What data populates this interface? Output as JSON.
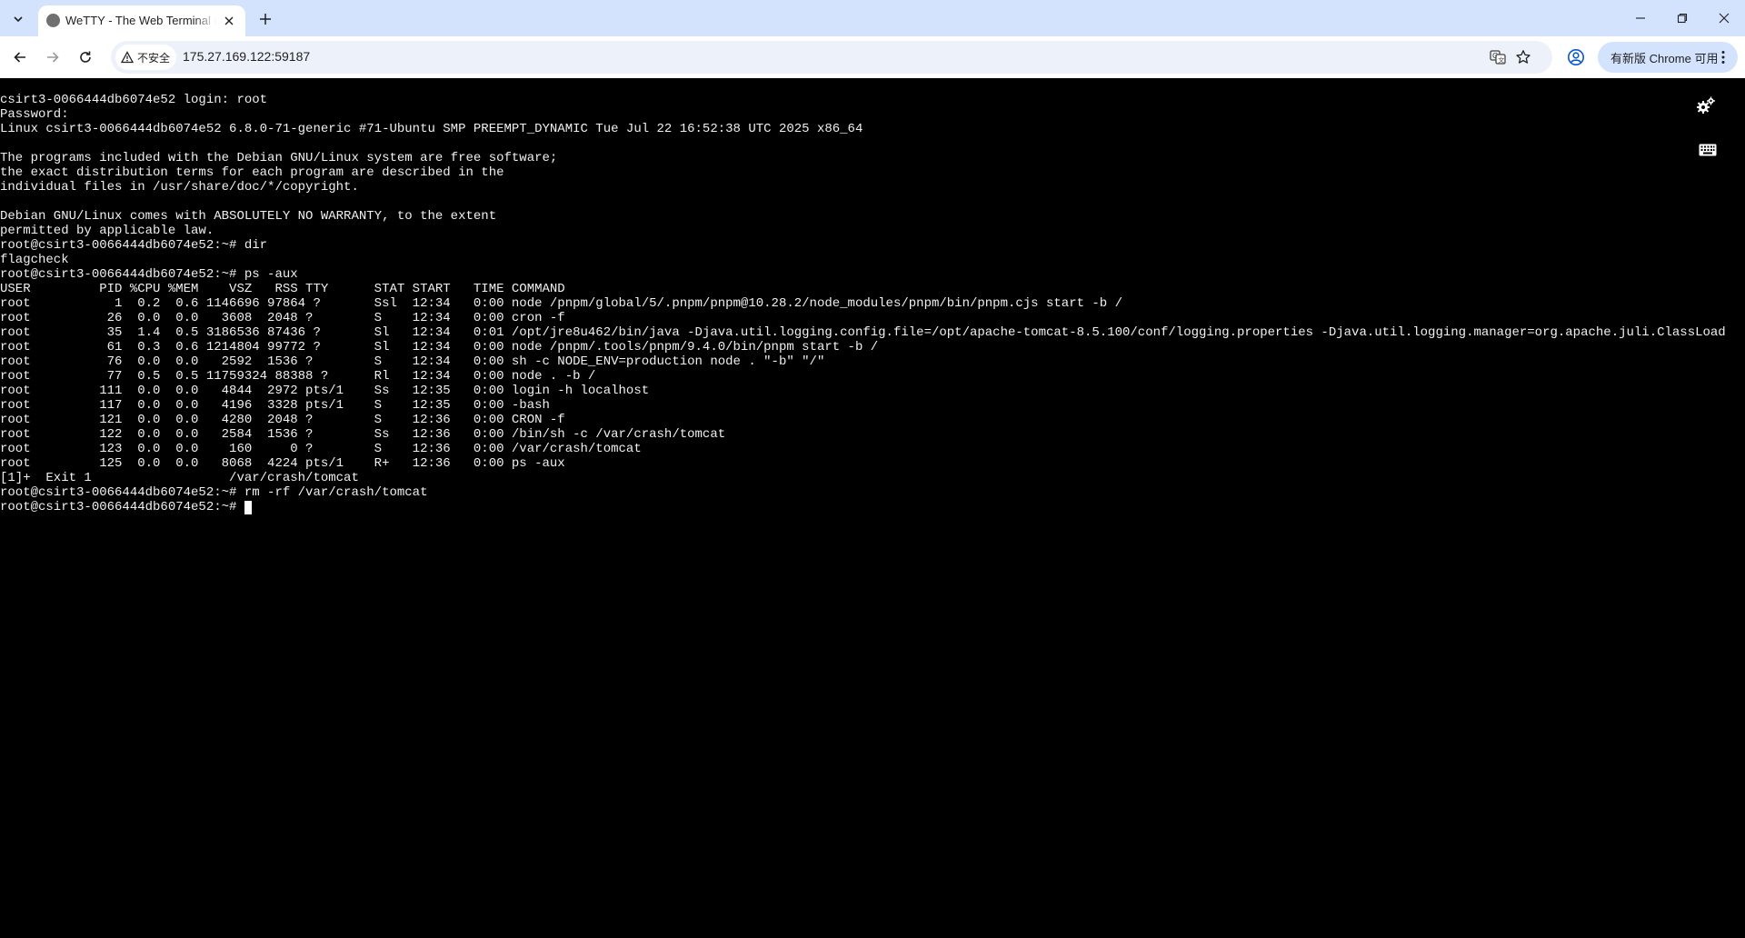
{
  "tab": {
    "title": "WeTTY - The Web Terminal Emulator"
  },
  "toolbar": {
    "security_label": "不安全",
    "url": "175.27.169.122:59187",
    "update_button_label": "有新版 Chrome 可用"
  },
  "icons": {
    "tab_search": "chevron-down-icon",
    "tab_close": "close-icon",
    "new_tab": "plus-icon",
    "minimize": "minimize-icon",
    "restore": "restore-icon",
    "window_close": "close-icon",
    "back": "arrow-left-icon",
    "forward": "arrow-right-icon",
    "reload": "reload-icon",
    "not_secure": "warning-triangle-icon",
    "translate": "translate-icon",
    "bookmark": "star-icon",
    "profile": "profile-icon",
    "menu": "vertical-dots-icon",
    "settings": "gears-icon",
    "keyboard": "keyboard-icon"
  },
  "terminal": {
    "lines": [
      "csirt3-0066444db6074e52 login: root",
      "Password:",
      "Linux csirt3-0066444db6074e52 6.8.0-71-generic #71-Ubuntu SMP PREEMPT_DYNAMIC Tue Jul 22 16:52:38 UTC 2025 x86_64",
      "",
      "The programs included with the Debian GNU/Linux system are free software;",
      "the exact distribution terms for each program are described in the",
      "individual files in /usr/share/doc/*/copyright.",
      "",
      "Debian GNU/Linux comes with ABSOLUTELY NO WARRANTY, to the extent",
      "permitted by applicable law.",
      "root@csirt3-0066444db6074e52:~# dir",
      "flagcheck",
      "root@csirt3-0066444db6074e52:~# ps -aux",
      "USER         PID %CPU %MEM    VSZ   RSS TTY      STAT START   TIME COMMAND",
      "root           1  0.2  0.6 1146696 97864 ?       Ssl  12:34   0:00 node /pnpm/global/5/.pnpm/pnpm@10.28.2/node_modules/pnpm/bin/pnpm.cjs start -b /",
      "root          26  0.0  0.0   3608  2048 ?        S    12:34   0:00 cron -f",
      "root          35  1.4  0.5 3186536 87436 ?       Sl   12:34   0:01 /opt/jre8u462/bin/java -Djava.util.logging.config.file=/opt/apache-tomcat-8.5.100/conf/logging.properties -Djava.util.logging.manager=org.apache.juli.ClassLoad",
      "root          61  0.3  0.6 1214804 99772 ?       Sl   12:34   0:00 node /pnpm/.tools/pnpm/9.4.0/bin/pnpm start -b /",
      "root          76  0.0  0.0   2592  1536 ?        S    12:34   0:00 sh -c NODE_ENV=production node . \"-b\" \"/\"",
      "root          77  0.5  0.5 11759324 88388 ?      Rl   12:34   0:00 node . -b /",
      "root         111  0.0  0.0   4844  2972 pts/1    Ss   12:35   0:00 login -h localhost",
      "root         117  0.0  0.0   4196  3328 pts/1    S    12:35   0:00 -bash",
      "root         121  0.0  0.0   4280  2048 ?        S    12:36   0:00 CRON -f",
      "root         122  0.0  0.0   2584  1536 ?        Ss   12:36   0:00 /bin/sh -c /var/crash/tomcat",
      "root         123  0.0  0.0    160     0 ?        S    12:36   0:00 /var/crash/tomcat",
      "root         125  0.0  0.0   8068  4224 pts/1    R+   12:36   0:00 ps -aux",
      "[1]+  Exit 1                  /var/crash/tomcat",
      "root@csirt3-0066444db6074e52:~# rm -rf /var/crash/tomcat"
    ],
    "prompt": "root@csirt3-0066444db6074e52:~# "
  }
}
